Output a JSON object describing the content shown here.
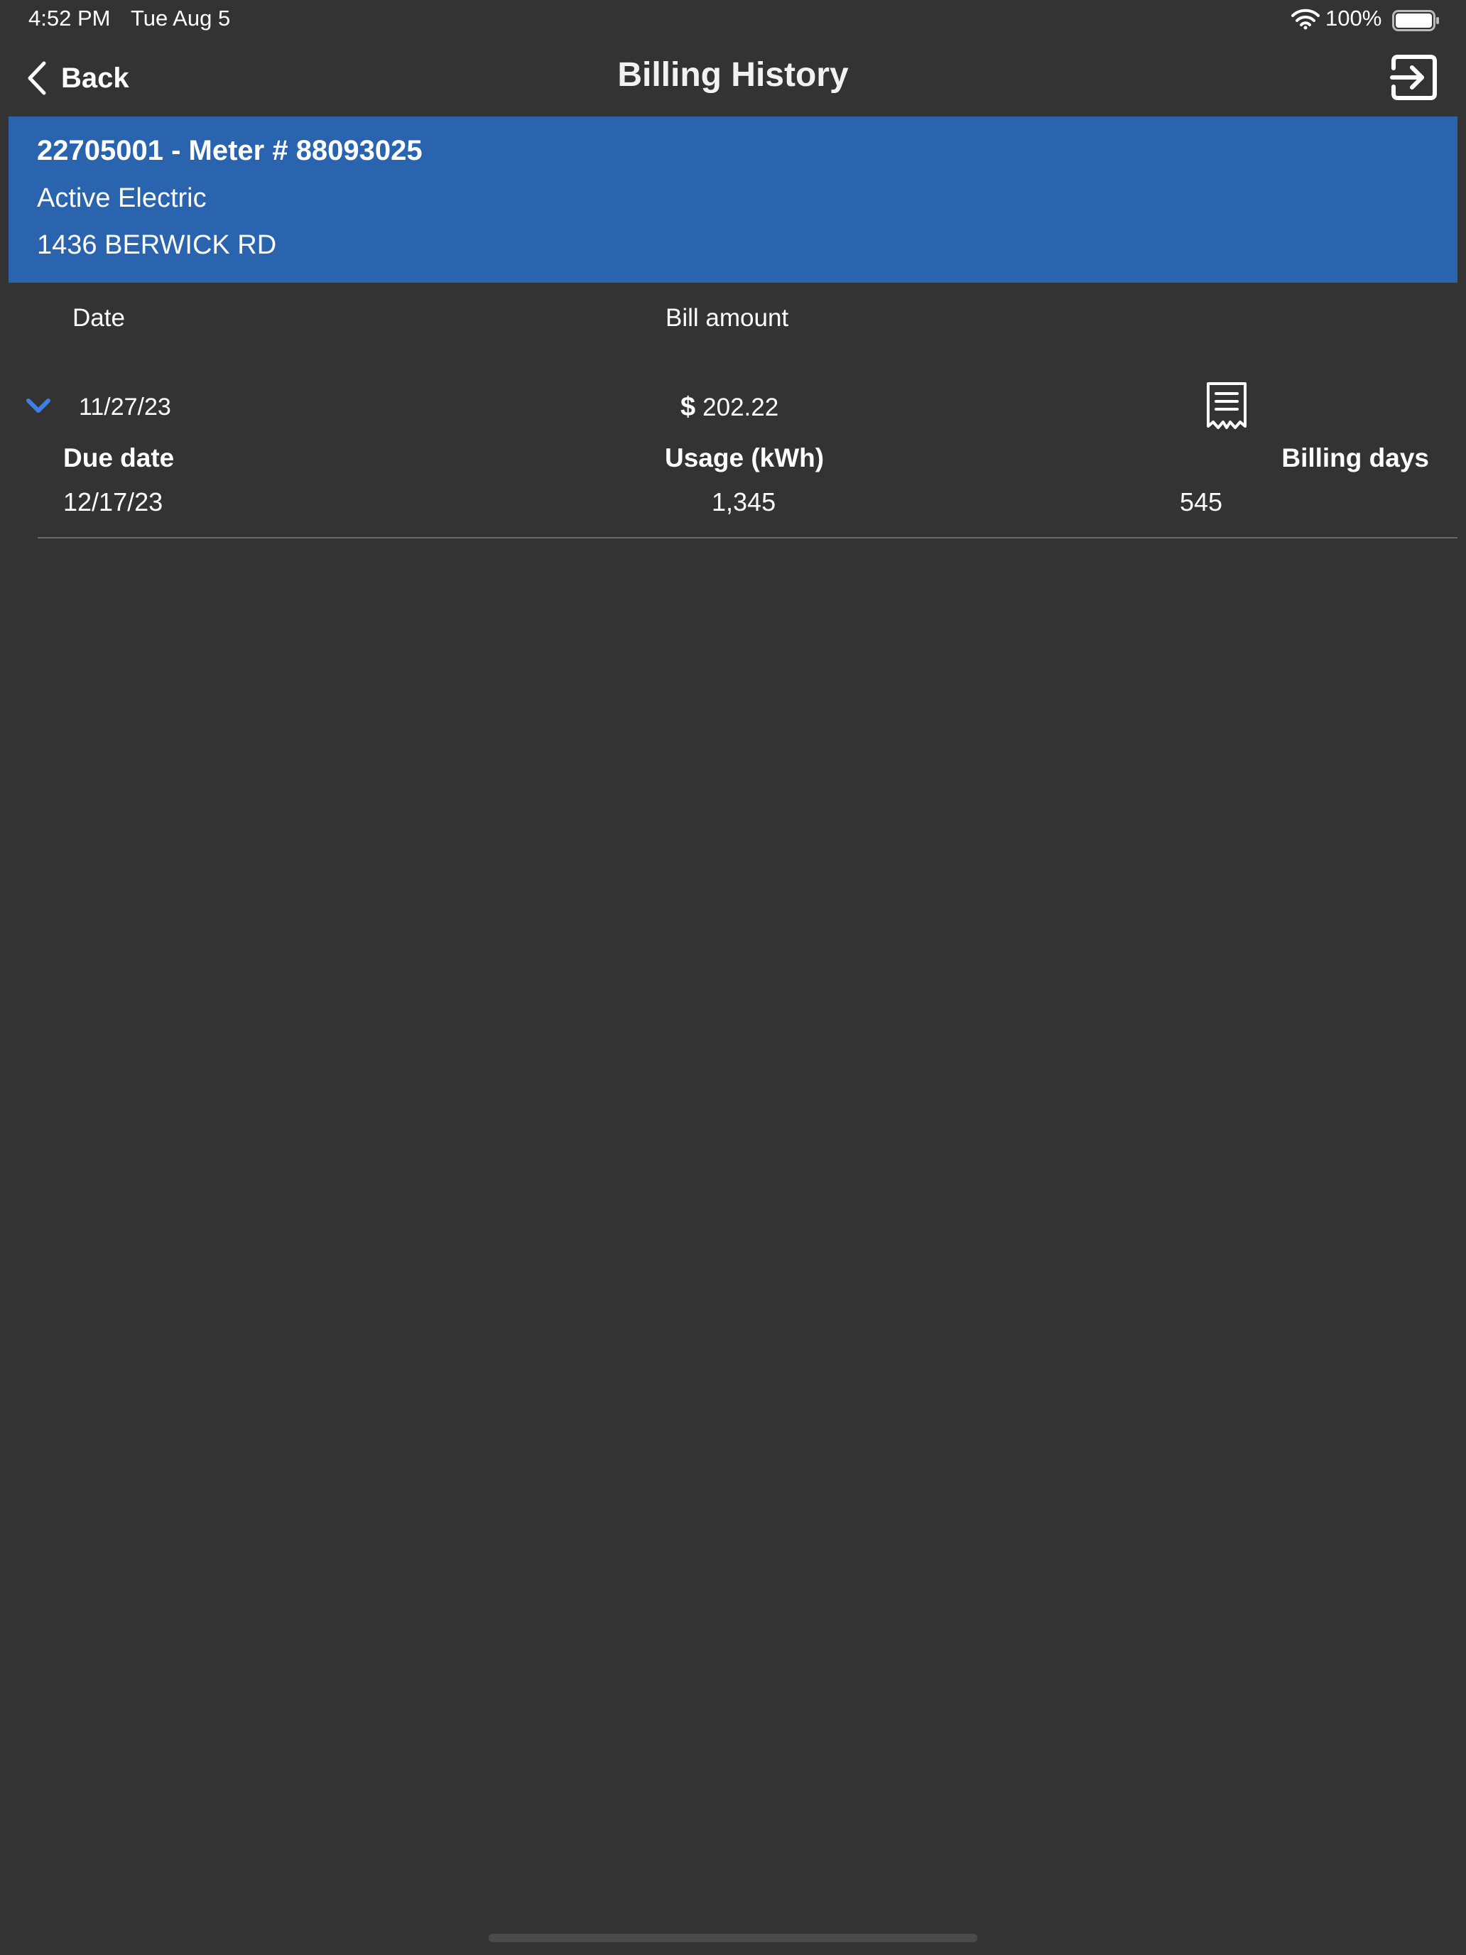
{
  "status_bar": {
    "time": "4:52 PM",
    "date": "Tue Aug 5",
    "battery": "100%"
  },
  "nav": {
    "back_label": "Back",
    "title": "Billing History"
  },
  "account": {
    "line1": "22705001 - Meter # 88093025",
    "line2": "Active Electric",
    "line3": "1436 BERWICK RD"
  },
  "table": {
    "headers": {
      "date": "Date",
      "amount": "Bill amount"
    },
    "rows": [
      {
        "date": "11/27/23",
        "currency": "$",
        "amount": "202.22",
        "expanded": true,
        "details": {
          "due_label": "Due date",
          "due_value": "12/17/23",
          "usage_label": "Usage (kWh)",
          "usage_value": "1,345",
          "days_label": "Billing days",
          "days_value": "545"
        }
      }
    ]
  },
  "colors": {
    "background": "#333333",
    "banner": "#2a63ae",
    "accent": "#3d7fe6",
    "text": "#ffffff"
  },
  "icons": {
    "back": "chevron-left-icon",
    "logout": "logout-icon",
    "expand": "chevron-down-icon",
    "receipt": "receipt-icon",
    "wifi": "wifi-icon",
    "battery": "battery-icon"
  }
}
